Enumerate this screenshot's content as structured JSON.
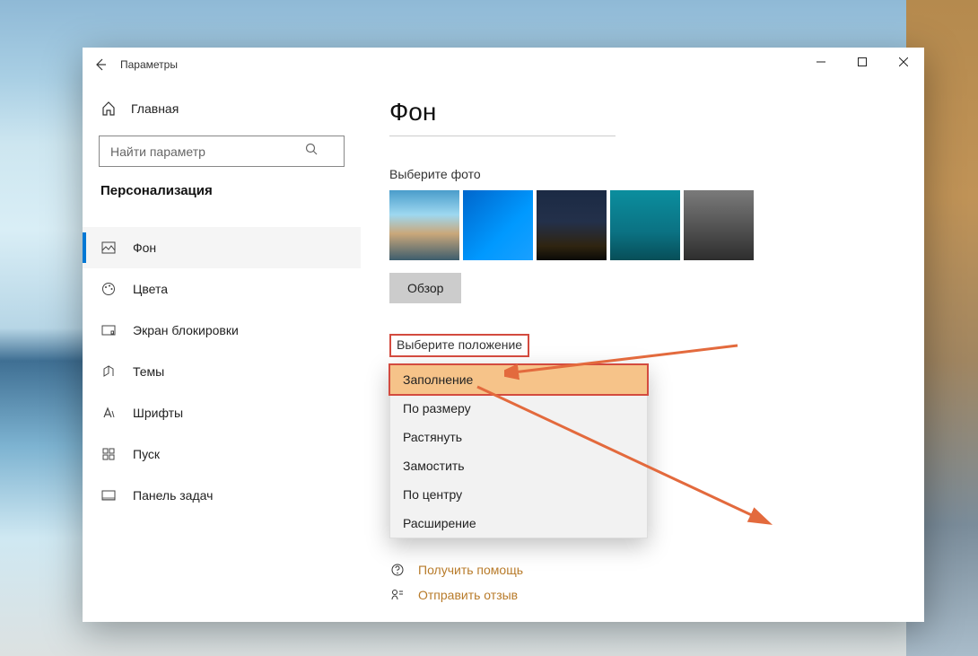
{
  "window": {
    "title": "Параметры"
  },
  "sidebar": {
    "home": "Главная",
    "search_placeholder": "Найти параметр",
    "section": "Персонализация",
    "items": [
      {
        "label": "Фон",
        "icon": "picture",
        "selected": true
      },
      {
        "label": "Цвета",
        "icon": "palette",
        "selected": false
      },
      {
        "label": "Экран блокировки",
        "icon": "lock-screen",
        "selected": false
      },
      {
        "label": "Темы",
        "icon": "themes",
        "selected": false
      },
      {
        "label": "Шрифты",
        "icon": "fonts",
        "selected": false
      },
      {
        "label": "Пуск",
        "icon": "start",
        "selected": false
      },
      {
        "label": "Панель задач",
        "icon": "taskbar",
        "selected": false
      }
    ]
  },
  "content": {
    "heading": "Фон",
    "choose_photo": "Выберите фото",
    "browse": "Обзор",
    "position_label": "Выберите положение",
    "position_options": [
      "Заполнение",
      "По размеру",
      "Растянуть",
      "Замостить",
      "По центру",
      "Расширение"
    ],
    "position_selected_index": 0,
    "help": "Получить помощь",
    "feedback": "Отправить отзыв"
  },
  "colors": {
    "accent": "#0078d4",
    "annotation": "#e36a3d",
    "highlight_border": "#d34b3f"
  }
}
